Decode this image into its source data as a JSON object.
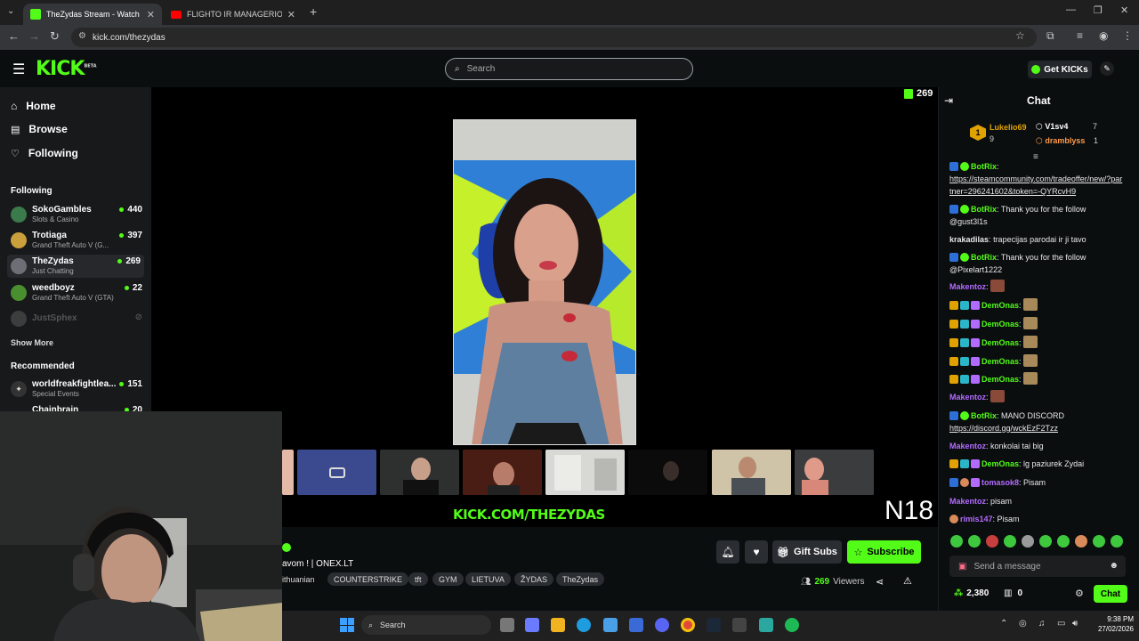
{
  "browser": {
    "tabs": [
      {
        "title": "TheZydas Stream - Watch Live o",
        "active": true
      },
      {
        "title": "FLIGHTO IR MANAGERIO PIRM",
        "active": false
      }
    ],
    "url": "kick.com/thezydas"
  },
  "header": {
    "logo": "KICK",
    "logo_beta": "BETA",
    "search_placeholder": "Search",
    "get_kicks": "Get KICKs"
  },
  "sidebar": {
    "nav": [
      {
        "label": "Home",
        "icon": "home-icon"
      },
      {
        "label": "Browse",
        "icon": "browse-icon"
      },
      {
        "label": "Following",
        "icon": "heart-icon"
      }
    ],
    "following_heading": "Following",
    "following": [
      {
        "name": "SokoGambles",
        "category": "Slots & Casino",
        "viewers": "440",
        "color": "#3b7a4a"
      },
      {
        "name": "Trotiaga",
        "category": "Grand Theft Auto V (G...",
        "viewers": "397",
        "color": "#c9a03b"
      },
      {
        "name": "TheZydas",
        "category": "Just Chatting",
        "viewers": "269",
        "color": "#6c6f75"
      },
      {
        "name": "weedboyz",
        "category": "Grand Theft Auto V (GTA)",
        "viewers": "22",
        "color": "#4a8f2f"
      },
      {
        "name": "JustSphex",
        "category": "",
        "viewers": "",
        "color": "#888"
      }
    ],
    "show_more": "Show More",
    "recommended_heading": "Recommended",
    "recommended": [
      {
        "name": "worldfreakfightlea...",
        "category": "Special Events",
        "viewers": "151",
        "color": "#ddd"
      },
      {
        "name": "Chainbrain",
        "category": "",
        "viewers": "20",
        "color": "#999"
      }
    ]
  },
  "player": {
    "viewer_count": "269",
    "watermark": "KICK.COM/THEZYDAS",
    "rating": "N18"
  },
  "stream": {
    "title": "avom ! | ONEX.LT",
    "tags": [
      "ithuanian",
      "COUNTERSTRIKE",
      "tft",
      "GYM",
      "LIETUVA",
      "ŽYDAS",
      "TheZydas"
    ],
    "gift_subs": "Gift Subs",
    "subscribe": "Subscribe",
    "viewers_count": "269",
    "viewers_label": "Viewers"
  },
  "chat": {
    "title": "Chat",
    "leaderboard": [
      {
        "name": "Lukelio69",
        "count": "9",
        "rank": "1"
      },
      {
        "name": "V1sv4",
        "count": "7"
      },
      {
        "name": "dramblyss",
        "count": "1"
      }
    ],
    "messages": [
      {
        "user": "BotRix",
        "color": "#53fc18",
        "text": "",
        "link": "https://steamcommunity.com/tradeoffer/new/?partner=296241602&token=-QYRcvH9"
      },
      {
        "user": "BotRix",
        "color": "#53fc18",
        "text": "Thank you for the follow @gust3l1s",
        "link": ""
      },
      {
        "user": "krakadilas",
        "color": "#e8e8e8",
        "text": "trapecijas parodai ir ji tavo",
        "link": ""
      },
      {
        "user": "BotRix",
        "color": "#53fc18",
        "text": "Thank you for the follow @Pixelart1222",
        "link": ""
      },
      {
        "user": "Makentoz",
        "color": "#b26bff",
        "text": "",
        "link": ""
      },
      {
        "user": "DemOnas",
        "color": "#53fc18",
        "text": "",
        "link": ""
      },
      {
        "user": "DemOnas",
        "color": "#53fc18",
        "text": "",
        "link": ""
      },
      {
        "user": "DemOnas",
        "color": "#53fc18",
        "text": "",
        "link": ""
      },
      {
        "user": "DemOnas",
        "color": "#53fc18",
        "text": "",
        "link": ""
      },
      {
        "user": "DemOnas",
        "color": "#53fc18",
        "text": "",
        "link": ""
      },
      {
        "user": "Makentoz",
        "color": "#b26bff",
        "text": "",
        "link": ""
      },
      {
        "user": "BotRix",
        "color": "#53fc18",
        "text": "MANO DISCORD",
        "link": "https://discord.gg/wckEzF2Tzz"
      },
      {
        "user": "Makentoz",
        "color": "#b26bff",
        "text": "konkolai tai big",
        "link": ""
      },
      {
        "user": "DemOnas",
        "color": "#53fc18",
        "text": "lg paziurek Zydai",
        "link": ""
      },
      {
        "user": "tomasok8",
        "color": "#b26bff",
        "text": "Pisam",
        "link": ""
      },
      {
        "user": "Makentoz",
        "color": "#b26bff",
        "text": "pisam",
        "link": ""
      },
      {
        "user": "rimis147",
        "color": "#b26bff",
        "text": "Pisam",
        "link": ""
      }
    ],
    "input_placeholder": "Send a message",
    "points": "2,380",
    "gifts": "0",
    "chat_button": "Chat"
  },
  "taskbar": {
    "search": "Search",
    "time": "9:38 PM",
    "date": "27/02/2026"
  }
}
